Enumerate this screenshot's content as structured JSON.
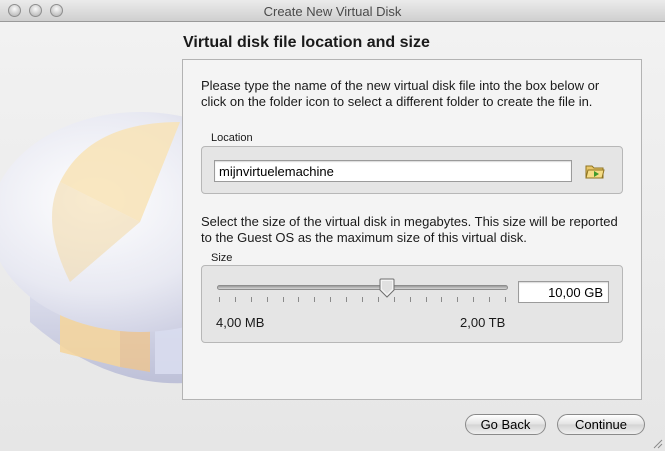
{
  "window": {
    "title": "Create New Virtual Disk"
  },
  "page": {
    "title": "Virtual disk file location and size"
  },
  "intro_text": "Please type the name of the new virtual disk file into the box below or click on the folder icon to select a different folder to create the file in.",
  "location": {
    "label": "Location",
    "value": "mijnvirtuelemachine"
  },
  "size": {
    "description": "Select the size of the virtual disk in megabytes. This size will be reported to the Guest OS as the maximum size of this virtual disk.",
    "label": "Size",
    "value": "10,00 GB",
    "min_label": "4,00 MB",
    "max_label": "2,00 TB"
  },
  "buttons": {
    "back": "Go Back",
    "continue": "Continue"
  },
  "icons": {
    "folder": "folder-icon",
    "slider_thumb": "slider-thumb-icon"
  }
}
